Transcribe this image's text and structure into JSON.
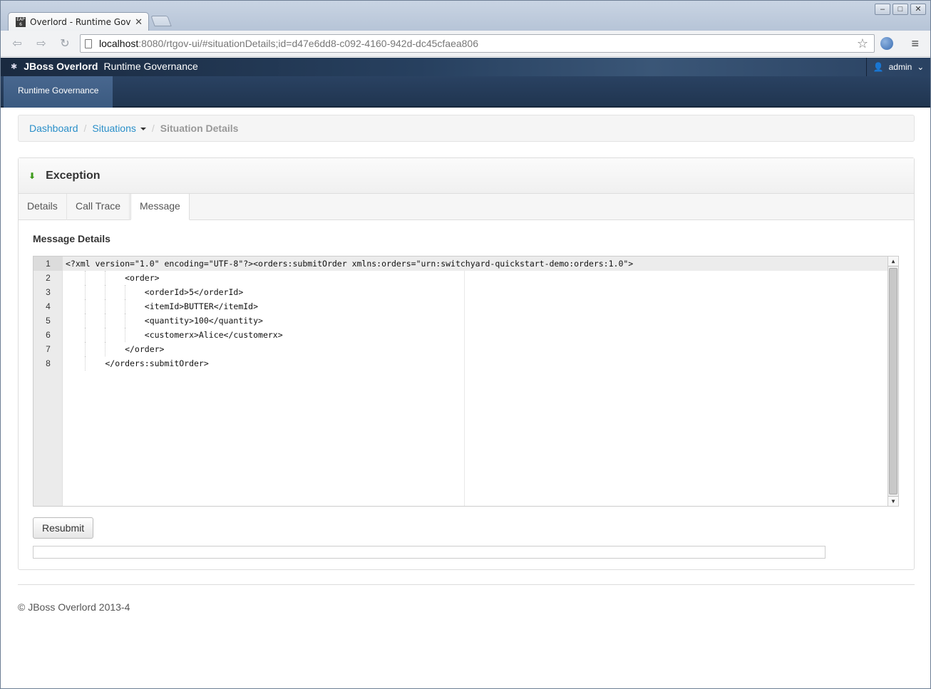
{
  "browser": {
    "tab_title": "Overlord - Runtime Gover",
    "tab_favicon_text": "EAP 6",
    "url_host": "localhost",
    "url_rest": ":8080/rtgov-ui/#situationDetails;id=d47e6dd8-c092-4160-942d-dc45cfaea806"
  },
  "header": {
    "brand_bold": "JBoss Overlord",
    "brand_rest": "Runtime Governance",
    "user": "admin",
    "nav_item": "Runtime Governance"
  },
  "breadcrumb": {
    "dashboard": "Dashboard",
    "situations": "Situations",
    "current": "Situation Details"
  },
  "panel": {
    "title": "Exception",
    "tabs": [
      "Details",
      "Call Trace",
      "Message"
    ],
    "active_tab": "Message",
    "section_title": "Message Details",
    "resubmit_label": "Resubmit"
  },
  "editor": {
    "lines": [
      {
        "num": "1",
        "code": "<?xml version=\"1.0\" encoding=\"UTF-8\"?><orders:submitOrder xmlns:orders=\"urn:switchyard-quickstart-demo:orders:1.0\">"
      },
      {
        "num": "2",
        "code": "            <order>"
      },
      {
        "num": "3",
        "code": "                <orderId>5</orderId>"
      },
      {
        "num": "4",
        "code": "                <itemId>BUTTER</itemId>"
      },
      {
        "num": "5",
        "code": "                <quantity>100</quantity>"
      },
      {
        "num": "6",
        "code": "                <customerx>Alice</customerx>"
      },
      {
        "num": "7",
        "code": "            </order>"
      },
      {
        "num": "8",
        "code": "        </orders:submitOrder>"
      }
    ]
  },
  "footer": {
    "copyright": "© JBoss Overlord 2013-4"
  }
}
